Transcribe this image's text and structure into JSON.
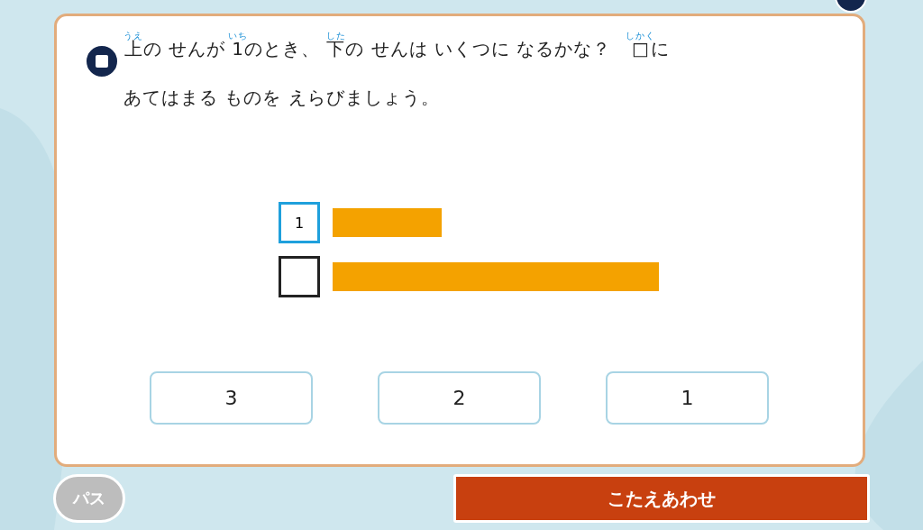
{
  "question": {
    "lines": [
      [
        {
          "text": "上",
          "ruby": "うえ"
        },
        {
          "text": "の せんが "
        },
        {
          "text": "1",
          "ruby": "いち"
        },
        {
          "text": "のとき、 "
        },
        {
          "text": "下",
          "ruby": "した"
        },
        {
          "text": "の せんは いくつに なるかな？　"
        },
        {
          "text": "□",
          "ruby": "しかく"
        },
        {
          "text": "に"
        }
      ],
      [
        {
          "text": "あてはまる ものを えらびましょう。"
        }
      ]
    ]
  },
  "bars": [
    {
      "kind": "given",
      "label": "1"
    },
    {
      "kind": "unknown"
    }
  ],
  "choices": [
    "3",
    "2",
    "1"
  ],
  "pass_button": "パス",
  "answer_button": "こたえあわせ"
}
